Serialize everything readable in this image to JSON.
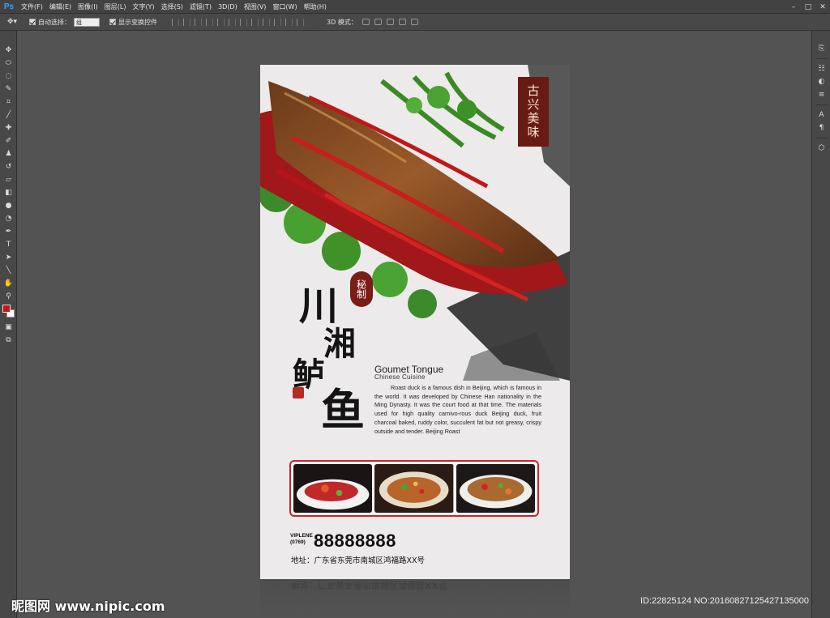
{
  "app": {
    "logo": "Ps",
    "menu": [
      "文件(F)",
      "编辑(E)",
      "图像(I)",
      "图层(L)",
      "文字(Y)",
      "选择(S)",
      "滤镜(T)",
      "3D(D)",
      "视图(V)",
      "窗口(W)",
      "帮助(H)"
    ],
    "window_controls": [
      "–",
      "□",
      "✕"
    ]
  },
  "options": {
    "auto_select_label": "自动选择：",
    "auto_select_value": "组",
    "show_transform_label": "显示变换控件",
    "mode_3d_label": "3D 模式："
  },
  "poster": {
    "badge_text": "古兴美味",
    "secret_label": "秘制",
    "dish_chars": [
      "川",
      "湘",
      "鲈",
      "鱼"
    ],
    "title_en": "Goumet Tongue",
    "subtitle_en": "Chinese  Cuisine",
    "description": "Roast duck is a famous dish in Beijing, which is famous in the world. It was developed by Chinese Han nationality in the Ming Dynasty. It was the court food at that time. The materials used for high quality carnivo-rous duck Beijing duck, fruit charcoal baked, ruddy color, succulent fat but not greasy, crispy outside and tender. Beijing Roast",
    "phone_label_1": "VIPLENE",
    "phone_label_2": "(0769)",
    "phone_number": "88888888",
    "address": "地址：广东省东莞市南城区鸿福路XX号"
  },
  "reflection_text": "地址：广东省东莞市南城区鸿福路XX号",
  "watermark": {
    "site": "昵图网 www.nipic.com",
    "id_text": "ID:22825124 NO:20160827125427135000"
  },
  "colors": {
    "chrome_bg": "#535353",
    "accent_red": "#c8242b",
    "seal_red": "#6a1a14",
    "foreground_swatch": "#c8141a"
  }
}
